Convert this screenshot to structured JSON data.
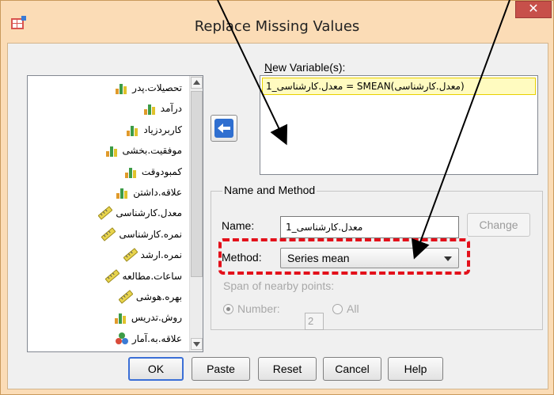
{
  "window": {
    "title": "Replace Missing Values",
    "close_glyph": "✕",
    "app_icon": "spss-dialog-icon"
  },
  "variables": {
    "items": [
      {
        "label": "تحصیلات.پدر",
        "icon": "nominal-bar-icon"
      },
      {
        "label": "درآمد",
        "icon": "nominal-bar-icon"
      },
      {
        "label": "کاربردزیاد",
        "icon": "nominal-bar-icon"
      },
      {
        "label": "موفقیت.بخشی",
        "icon": "nominal-bar-icon"
      },
      {
        "label": "کمبودوقت",
        "icon": "nominal-bar-icon"
      },
      {
        "label": "علاقه.داشتن",
        "icon": "nominal-bar-icon"
      },
      {
        "label": "معدل.کارشناسی",
        "icon": "scale-ruler-icon"
      },
      {
        "label": "نمره.کارشناسی",
        "icon": "scale-ruler-icon"
      },
      {
        "label": "نمره.ارشد",
        "icon": "scale-ruler-icon"
      },
      {
        "label": "ساعات.مطالعه",
        "icon": "scale-ruler-icon"
      },
      {
        "label": "بهره.هوشی",
        "icon": "scale-ruler-icon"
      },
      {
        "label": "روش.تدریس",
        "icon": "nominal-bar-icon"
      },
      {
        "label": "علاقه.به.آمار",
        "icon": "ordinal-circles-icon"
      }
    ]
  },
  "new_variables": {
    "label": "New Variable(s):",
    "items": [
      "معدل.کارشناسی_1 = SMEAN(معدل.کارشناسی)"
    ]
  },
  "name_method": {
    "group_title": "Name and Method",
    "name_label": "Name:",
    "name_value": "معدل.کارشناسی_1",
    "change_label": "Change",
    "method_label": "Method:",
    "method_value": "Series mean",
    "span_label": "Span of nearby points:",
    "number_label": "Number:",
    "number_value": "2",
    "all_label": "All"
  },
  "buttons": {
    "ok": "OK",
    "paste": "Paste",
    "reset": "Reset",
    "cancel": "Cancel",
    "help": "Help"
  },
  "colors": {
    "title_bar": "#fbdcb6",
    "close": "#c7504a",
    "highlight_dash": "#e3101a",
    "selected_item": "#fffbc0"
  }
}
